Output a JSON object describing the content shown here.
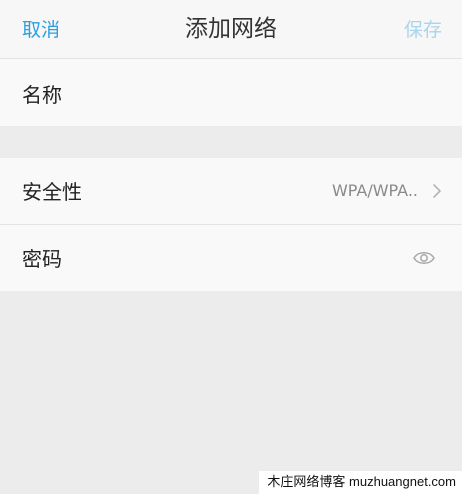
{
  "header": {
    "cancel_label": "取消",
    "title": "添加网络",
    "save_label": "保存"
  },
  "form": {
    "name_label": "名称",
    "security_label": "安全性",
    "security_value": "WPA/WPA..",
    "password_label": "密码"
  },
  "icons": {
    "security_chevron": "chevron-right-icon",
    "password_visibility": "eye-icon"
  },
  "watermark": "木庄网络博客 muzhuangnet.com",
  "colors": {
    "accent": "#2b9fe0",
    "accent_disabled": "#a9d4ef",
    "background": "#ececec",
    "row_background": "#f9f9f9"
  }
}
